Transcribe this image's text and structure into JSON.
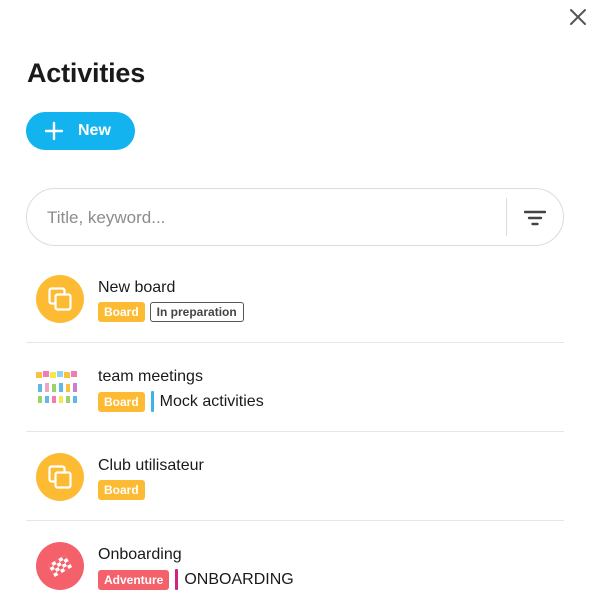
{
  "header": {
    "title": "Activities",
    "new_label": "New"
  },
  "search": {
    "placeholder": "Title, keyword..."
  },
  "colors": {
    "accent": "#12b3ef",
    "board": "#fcbb33",
    "adventure": "#f4616b",
    "mock_activities": "#3cb4e7",
    "onboarding": "#d0247e"
  },
  "items": [
    {
      "title": "New board",
      "type": "Board",
      "status": "In preparation",
      "icon": "board-icon"
    },
    {
      "title": "team meetings",
      "type": "Board",
      "category": "Mock activities",
      "icon": "team-meetings-thumbnail"
    },
    {
      "title": "Club utilisateur",
      "type": "Board",
      "icon": "board-icon"
    },
    {
      "title": "Onboarding",
      "type": "Adventure",
      "category": "ONBOARDING",
      "icon": "adventure-flag-icon"
    }
  ]
}
